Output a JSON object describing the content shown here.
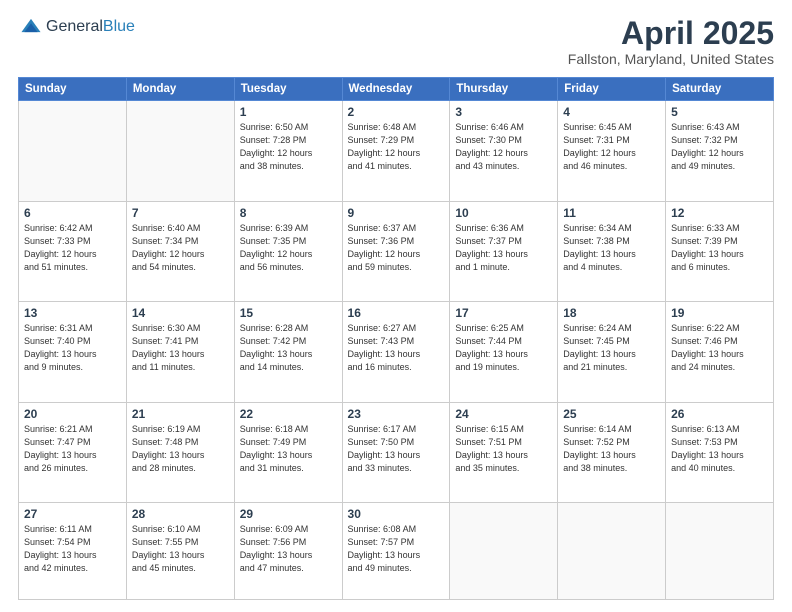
{
  "header": {
    "logo_general": "General",
    "logo_blue": "Blue",
    "month": "April 2025",
    "location": "Fallston, Maryland, United States"
  },
  "weekdays": [
    "Sunday",
    "Monday",
    "Tuesday",
    "Wednesday",
    "Thursday",
    "Friday",
    "Saturday"
  ],
  "weeks": [
    [
      {
        "day": "",
        "info": ""
      },
      {
        "day": "",
        "info": ""
      },
      {
        "day": "1",
        "info": "Sunrise: 6:50 AM\nSunset: 7:28 PM\nDaylight: 12 hours\nand 38 minutes."
      },
      {
        "day": "2",
        "info": "Sunrise: 6:48 AM\nSunset: 7:29 PM\nDaylight: 12 hours\nand 41 minutes."
      },
      {
        "day": "3",
        "info": "Sunrise: 6:46 AM\nSunset: 7:30 PM\nDaylight: 12 hours\nand 43 minutes."
      },
      {
        "day": "4",
        "info": "Sunrise: 6:45 AM\nSunset: 7:31 PM\nDaylight: 12 hours\nand 46 minutes."
      },
      {
        "day": "5",
        "info": "Sunrise: 6:43 AM\nSunset: 7:32 PM\nDaylight: 12 hours\nand 49 minutes."
      }
    ],
    [
      {
        "day": "6",
        "info": "Sunrise: 6:42 AM\nSunset: 7:33 PM\nDaylight: 12 hours\nand 51 minutes."
      },
      {
        "day": "7",
        "info": "Sunrise: 6:40 AM\nSunset: 7:34 PM\nDaylight: 12 hours\nand 54 minutes."
      },
      {
        "day": "8",
        "info": "Sunrise: 6:39 AM\nSunset: 7:35 PM\nDaylight: 12 hours\nand 56 minutes."
      },
      {
        "day": "9",
        "info": "Sunrise: 6:37 AM\nSunset: 7:36 PM\nDaylight: 12 hours\nand 59 minutes."
      },
      {
        "day": "10",
        "info": "Sunrise: 6:36 AM\nSunset: 7:37 PM\nDaylight: 13 hours\nand 1 minute."
      },
      {
        "day": "11",
        "info": "Sunrise: 6:34 AM\nSunset: 7:38 PM\nDaylight: 13 hours\nand 4 minutes."
      },
      {
        "day": "12",
        "info": "Sunrise: 6:33 AM\nSunset: 7:39 PM\nDaylight: 13 hours\nand 6 minutes."
      }
    ],
    [
      {
        "day": "13",
        "info": "Sunrise: 6:31 AM\nSunset: 7:40 PM\nDaylight: 13 hours\nand 9 minutes."
      },
      {
        "day": "14",
        "info": "Sunrise: 6:30 AM\nSunset: 7:41 PM\nDaylight: 13 hours\nand 11 minutes."
      },
      {
        "day": "15",
        "info": "Sunrise: 6:28 AM\nSunset: 7:42 PM\nDaylight: 13 hours\nand 14 minutes."
      },
      {
        "day": "16",
        "info": "Sunrise: 6:27 AM\nSunset: 7:43 PM\nDaylight: 13 hours\nand 16 minutes."
      },
      {
        "day": "17",
        "info": "Sunrise: 6:25 AM\nSunset: 7:44 PM\nDaylight: 13 hours\nand 19 minutes."
      },
      {
        "day": "18",
        "info": "Sunrise: 6:24 AM\nSunset: 7:45 PM\nDaylight: 13 hours\nand 21 minutes."
      },
      {
        "day": "19",
        "info": "Sunrise: 6:22 AM\nSunset: 7:46 PM\nDaylight: 13 hours\nand 24 minutes."
      }
    ],
    [
      {
        "day": "20",
        "info": "Sunrise: 6:21 AM\nSunset: 7:47 PM\nDaylight: 13 hours\nand 26 minutes."
      },
      {
        "day": "21",
        "info": "Sunrise: 6:19 AM\nSunset: 7:48 PM\nDaylight: 13 hours\nand 28 minutes."
      },
      {
        "day": "22",
        "info": "Sunrise: 6:18 AM\nSunset: 7:49 PM\nDaylight: 13 hours\nand 31 minutes."
      },
      {
        "day": "23",
        "info": "Sunrise: 6:17 AM\nSunset: 7:50 PM\nDaylight: 13 hours\nand 33 minutes."
      },
      {
        "day": "24",
        "info": "Sunrise: 6:15 AM\nSunset: 7:51 PM\nDaylight: 13 hours\nand 35 minutes."
      },
      {
        "day": "25",
        "info": "Sunrise: 6:14 AM\nSunset: 7:52 PM\nDaylight: 13 hours\nand 38 minutes."
      },
      {
        "day": "26",
        "info": "Sunrise: 6:13 AM\nSunset: 7:53 PM\nDaylight: 13 hours\nand 40 minutes."
      }
    ],
    [
      {
        "day": "27",
        "info": "Sunrise: 6:11 AM\nSunset: 7:54 PM\nDaylight: 13 hours\nand 42 minutes."
      },
      {
        "day": "28",
        "info": "Sunrise: 6:10 AM\nSunset: 7:55 PM\nDaylight: 13 hours\nand 45 minutes."
      },
      {
        "day": "29",
        "info": "Sunrise: 6:09 AM\nSunset: 7:56 PM\nDaylight: 13 hours\nand 47 minutes."
      },
      {
        "day": "30",
        "info": "Sunrise: 6:08 AM\nSunset: 7:57 PM\nDaylight: 13 hours\nand 49 minutes."
      },
      {
        "day": "",
        "info": ""
      },
      {
        "day": "",
        "info": ""
      },
      {
        "day": "",
        "info": ""
      }
    ]
  ]
}
